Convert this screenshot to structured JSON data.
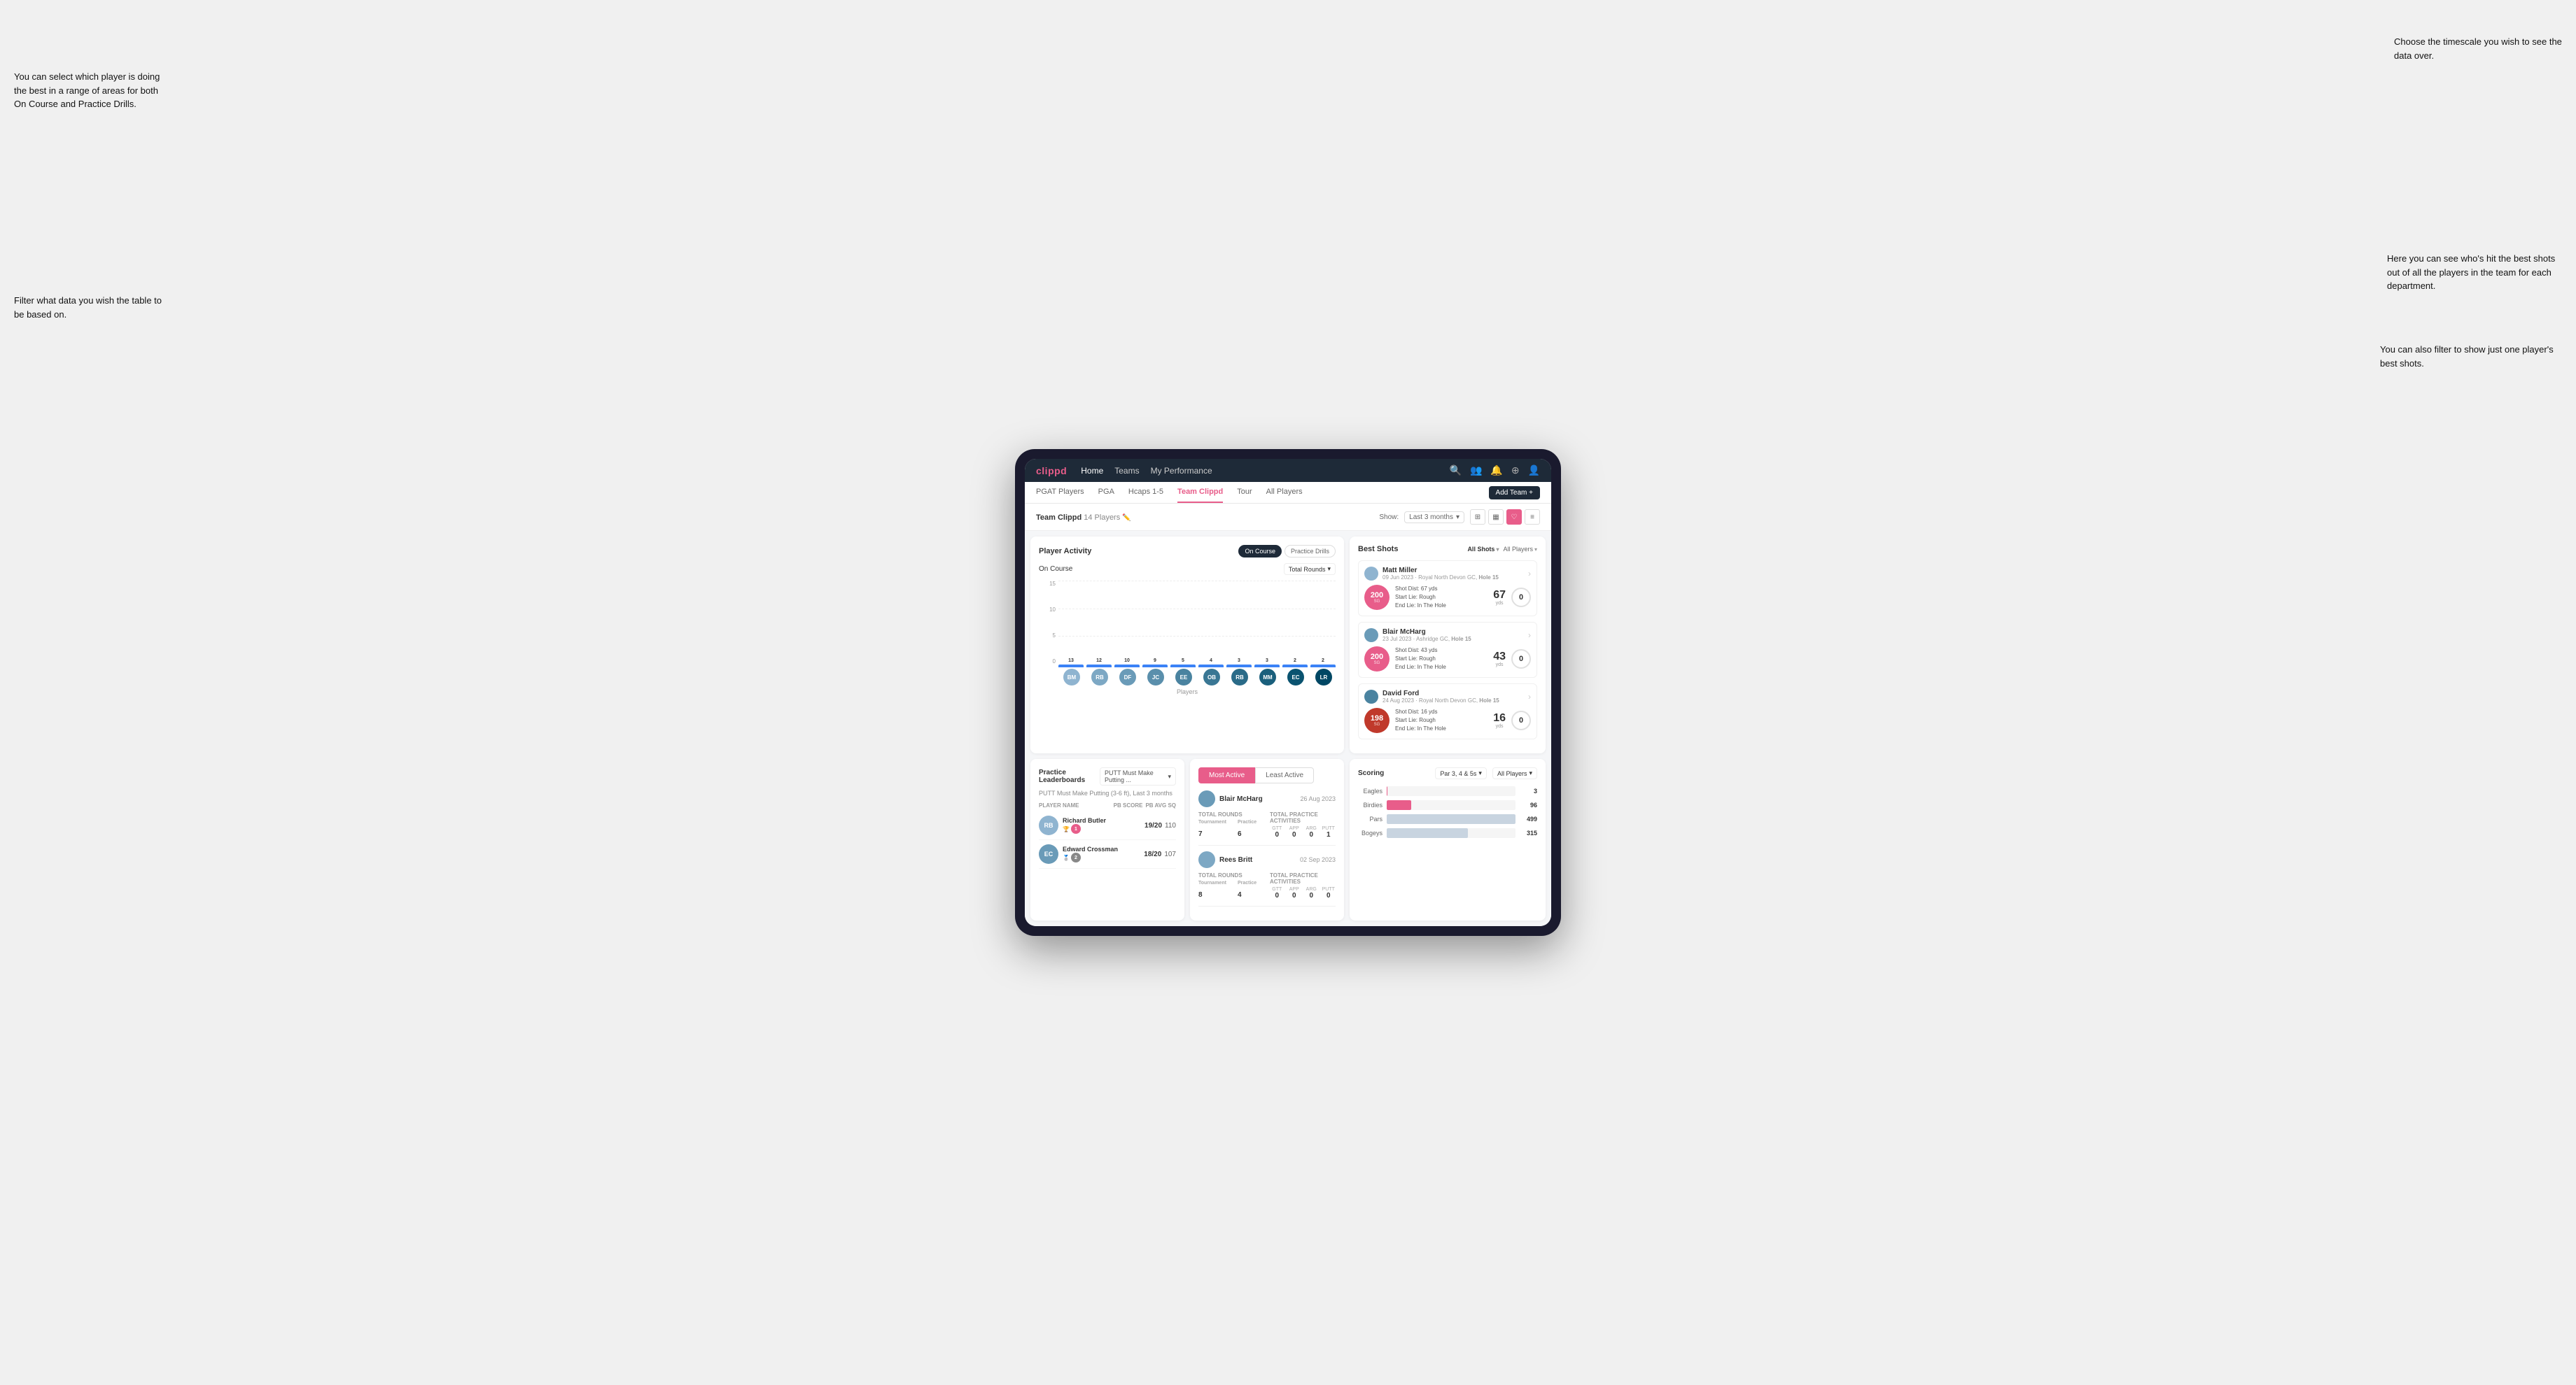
{
  "annotations": {
    "top_left": "You can select which player is doing the best in a range of areas for both On Course and Practice Drills.",
    "bottom_left": "Filter what data you wish the table to be based on.",
    "top_right": "Choose the timescale you wish to see the data over.",
    "middle_right": "Here you can see who's hit the best shots out of all the players in the team for each department.",
    "bottom_right": "You can also filter to show just one player's best shots."
  },
  "nav": {
    "logo": "clippd",
    "links": [
      "Home",
      "Teams",
      "My Performance"
    ],
    "icons": [
      "🔍",
      "👤",
      "🔔",
      "⊕",
      "👤"
    ]
  },
  "tabs": {
    "items": [
      "PGAT Players",
      "PGA",
      "Hcaps 1-5",
      "Team Clippd",
      "Tour",
      "All Players"
    ],
    "active": "Team Clippd",
    "add_button": "Add Team +"
  },
  "team_header": {
    "title": "Team Clippd",
    "count": "14 Players",
    "show_label": "Show:",
    "show_value": "Last 3 months",
    "view_icons": [
      "⊞",
      "▦",
      "♡",
      "≡"
    ]
  },
  "player_activity": {
    "title": "Player Activity",
    "toggle_on_course": "On Course",
    "toggle_practice": "Practice Drills",
    "chart_section_label": "On Course",
    "chart_dropdown": "Total Rounds",
    "y_axis": [
      "15",
      "10",
      "5",
      "0"
    ],
    "bars": [
      {
        "name": "B. McHarg",
        "value": 13,
        "height": 100
      },
      {
        "name": "R. Britt",
        "value": 12,
        "height": 92
      },
      {
        "name": "D. Ford",
        "value": 10,
        "height": 77
      },
      {
        "name": "J. Coles",
        "value": 9,
        "height": 69
      },
      {
        "name": "E. Ebert",
        "value": 5,
        "height": 38
      },
      {
        "name": "O. Billingham",
        "value": 4,
        "height": 31
      },
      {
        "name": "R. Butler",
        "value": 3,
        "height": 23
      },
      {
        "name": "M. Miller",
        "value": 3,
        "height": 23
      },
      {
        "name": "E. Crossman",
        "value": 2,
        "height": 15
      },
      {
        "name": "L. Robertson",
        "value": 2,
        "height": 15
      }
    ],
    "x_label": "Players",
    "y_label": "Total Rounds"
  },
  "best_shots": {
    "title": "Best Shots",
    "filter1": "All Shots",
    "filter2": "All Players",
    "players": [
      {
        "name": "Matt Miller",
        "date": "09 Jun 2023",
        "course": "Royal North Devon GC",
        "hole": "Hole 15",
        "badge_num": "200",
        "badge_label": "SG",
        "shot_dist": "Shot Dist: 67 yds",
        "start_lie": "Start Lie: Rough",
        "end_lie": "End Lie: In The Hole",
        "stat1": "67",
        "stat1_unit": "yds",
        "stat2": "0"
      },
      {
        "name": "Blair McHarg",
        "date": "23 Jul 2023",
        "course": "Ashridge GC",
        "hole": "Hole 15",
        "badge_num": "200",
        "badge_label": "SG",
        "shot_dist": "Shot Dist: 43 yds",
        "start_lie": "Start Lie: Rough",
        "end_lie": "End Lie: In The Hole",
        "stat1": "43",
        "stat1_unit": "yds",
        "stat2": "0"
      },
      {
        "name": "David Ford",
        "date": "24 Aug 2023",
        "course": "Royal North Devon GC",
        "hole": "Hole 15",
        "badge_num": "198",
        "badge_label": "SG",
        "shot_dist": "Shot Dist: 16 yds",
        "start_lie": "Start Lie: Rough",
        "end_lie": "End Lie: In The Hole",
        "stat1": "16",
        "stat1_unit": "yds",
        "stat2": "0"
      }
    ]
  },
  "leaderboard": {
    "title": "Practice Leaderboards",
    "dropdown": "PUTT Must Make Putting ...",
    "subtitle": "PUTT Must Make Putting (3-6 ft), Last 3 months",
    "col_name": "PLAYER NAME",
    "col_pb": "PB SCORE",
    "col_avg": "PB AVG SQ",
    "players": [
      {
        "name": "Richard Butler",
        "score": "19/20",
        "avg": "110",
        "rank": 1
      },
      {
        "name": "Edward Crossman",
        "score": "18/20",
        "avg": "107",
        "rank": 2
      }
    ]
  },
  "most_active": {
    "tab1": "Most Active",
    "tab2": "Least Active",
    "entries": [
      {
        "name": "Blair McHarg",
        "date": "26 Aug 2023",
        "total_rounds_label": "Total Rounds",
        "tournament": "7",
        "practice": "6",
        "total_practice_label": "Total Practice Activities",
        "gtt": "0",
        "app": "0",
        "arg": "0",
        "putt": "1"
      },
      {
        "name": "Rees Britt",
        "date": "02 Sep 2023",
        "total_rounds_label": "Total Rounds",
        "tournament": "8",
        "practice": "4",
        "total_practice_label": "Total Practice Activities",
        "gtt": "0",
        "app": "0",
        "arg": "0",
        "putt": "0"
      }
    ]
  },
  "scoring": {
    "title": "Scoring",
    "filter1": "Par 3, 4 & 5s",
    "filter2": "All Players",
    "bars": [
      {
        "label": "Eagles",
        "value": 3,
        "max": 500,
        "color": "#e85d8a"
      },
      {
        "label": "Birdies",
        "value": 96,
        "max": 500,
        "color": "#e85d8a"
      },
      {
        "label": "Pars",
        "value": 499,
        "max": 500,
        "color": "#c8d4e0"
      },
      {
        "label": "Bogeys",
        "value": 315,
        "max": 500,
        "color": "#c8d4e0"
      }
    ]
  }
}
